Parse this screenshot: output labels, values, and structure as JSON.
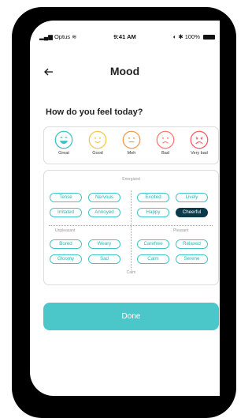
{
  "status_bar": {
    "carrier": "Optus",
    "time": "9:41 AM",
    "battery": "100%"
  },
  "header": {
    "back_icon": "arrow-left-icon",
    "title": "Mood"
  },
  "question": "How do you feel today?",
  "moods": [
    {
      "label": "Great",
      "color": "#3fc1c9"
    },
    {
      "label": "Good",
      "color": "#f2c94c"
    },
    {
      "label": "Meh",
      "color": "#f2994a"
    },
    {
      "label": "Bad",
      "color": "#ff7a6b"
    },
    {
      "label": "Very bad",
      "color": "#ff5a5f"
    }
  ],
  "grid": {
    "top_label": "Energized",
    "bottom_label": "Calm",
    "left_label": "Unpleasant",
    "right_label": "Pleasant",
    "chips": [
      [
        "Tense",
        "Nervous",
        "Excited",
        "Lively"
      ],
      [
        "Irritated",
        "Annoyed",
        "Happy",
        "Cheerful"
      ],
      [
        "Bored",
        "Weary",
        "Carefree",
        "Relaxed"
      ],
      [
        "Gloomy",
        "Sad",
        "Calm",
        "Serene"
      ]
    ],
    "selected": "Cheerful"
  },
  "done_label": "Done",
  "colors": {
    "accent": "#4cc7c9",
    "selected_chip": "#0c3a4a",
    "chip_text": "#2ab6b8"
  }
}
